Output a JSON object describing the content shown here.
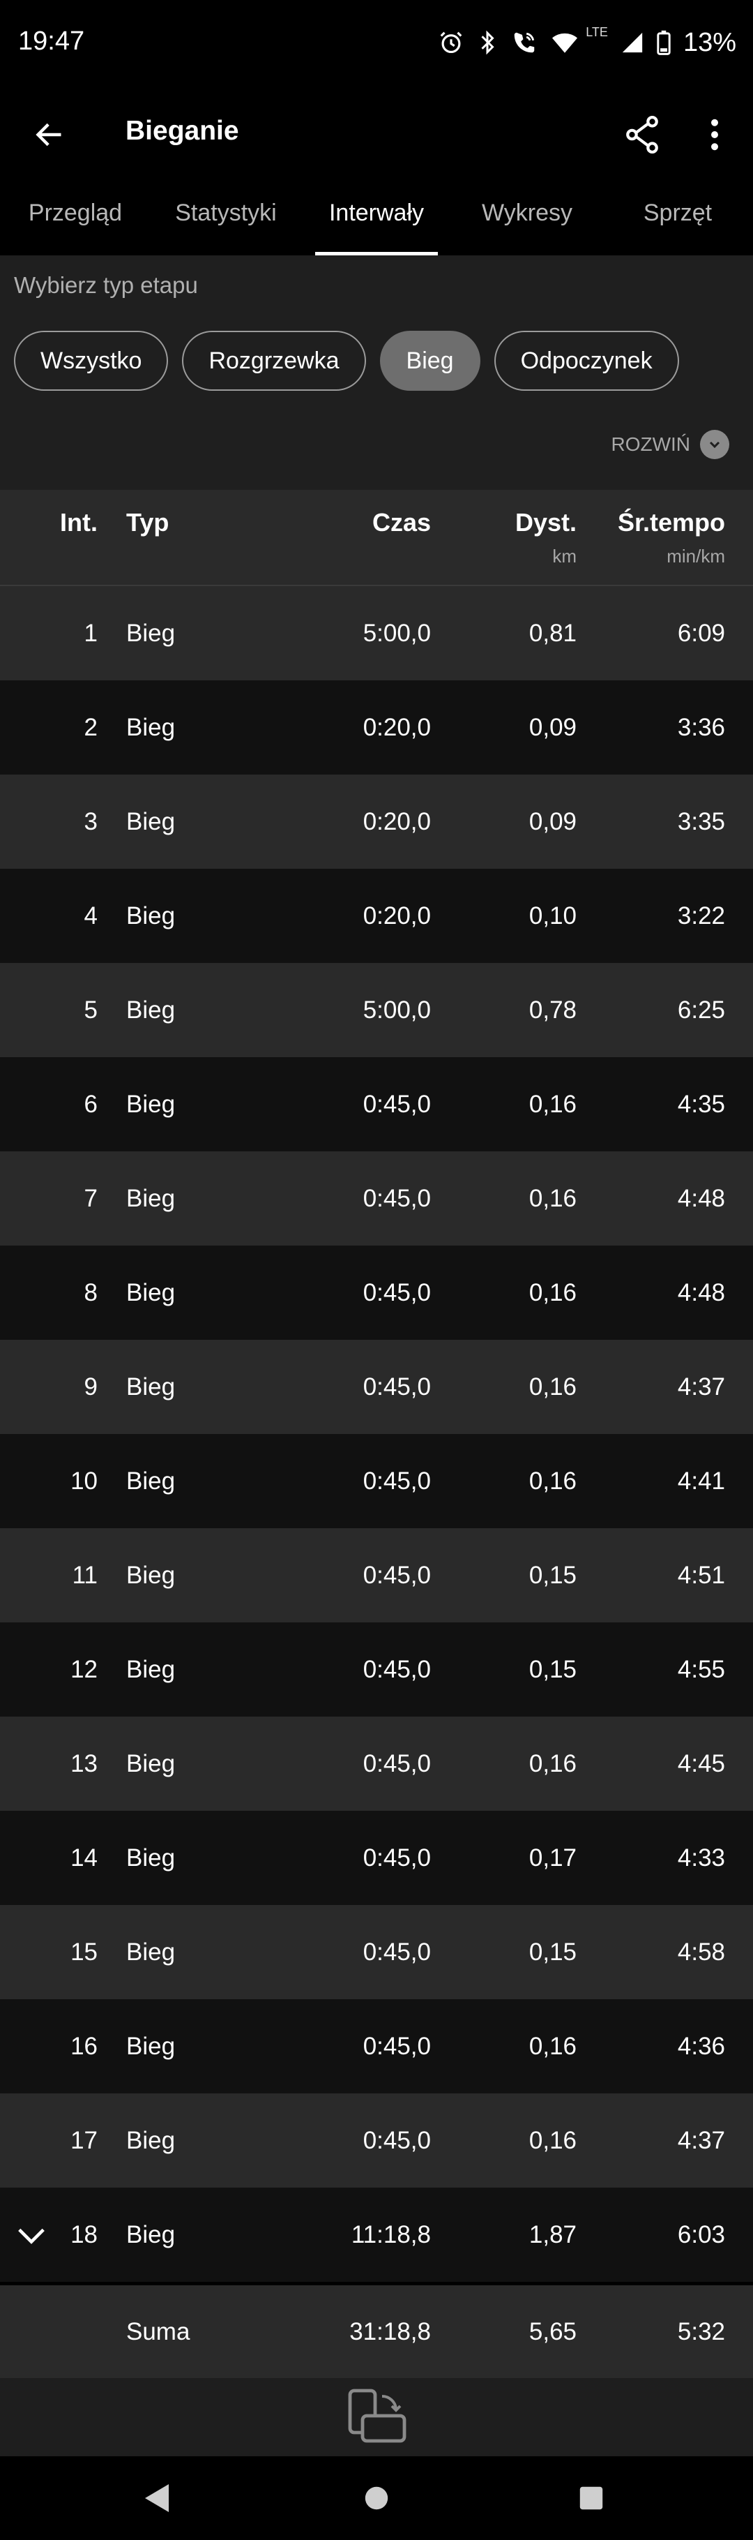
{
  "status_bar": {
    "time": "19:47",
    "battery": "13%",
    "lte": "LTE"
  },
  "app_bar": {
    "title": "Bieganie"
  },
  "tabs": [
    "Przegląd",
    "Statystyki",
    "Interwały",
    "Wykresy",
    "Sprzęt"
  ],
  "active_tab": 2,
  "filter": {
    "label": "Wybierz typ etapu",
    "chips": [
      "Wszystko",
      "Rozgrzewka",
      "Bieg",
      "Odpoczynek"
    ],
    "selected": 2,
    "expand_label": "ROZWIŃ"
  },
  "table": {
    "headers": {
      "int": "Int.",
      "typ": "Typ",
      "czas": "Czas",
      "dyst": "Dyst.",
      "dyst_unit": "km",
      "tempo": "Śr.tempo",
      "tempo_unit": "min/km"
    },
    "rows": [
      {
        "int": "1",
        "typ": "Bieg",
        "czas": "5:00,0",
        "dyst": "0,81",
        "tempo": "6:09"
      },
      {
        "int": "2",
        "typ": "Bieg",
        "czas": "0:20,0",
        "dyst": "0,09",
        "tempo": "3:36"
      },
      {
        "int": "3",
        "typ": "Bieg",
        "czas": "0:20,0",
        "dyst": "0,09",
        "tempo": "3:35"
      },
      {
        "int": "4",
        "typ": "Bieg",
        "czas": "0:20,0",
        "dyst": "0,10",
        "tempo": "3:22"
      },
      {
        "int": "5",
        "typ": "Bieg",
        "czas": "5:00,0",
        "dyst": "0,78",
        "tempo": "6:25"
      },
      {
        "int": "6",
        "typ": "Bieg",
        "czas": "0:45,0",
        "dyst": "0,16",
        "tempo": "4:35"
      },
      {
        "int": "7",
        "typ": "Bieg",
        "czas": "0:45,0",
        "dyst": "0,16",
        "tempo": "4:48"
      },
      {
        "int": "8",
        "typ": "Bieg",
        "czas": "0:45,0",
        "dyst": "0,16",
        "tempo": "4:48"
      },
      {
        "int": "9",
        "typ": "Bieg",
        "czas": "0:45,0",
        "dyst": "0,16",
        "tempo": "4:37"
      },
      {
        "int": "10",
        "typ": "Bieg",
        "czas": "0:45,0",
        "dyst": "0,16",
        "tempo": "4:41"
      },
      {
        "int": "11",
        "typ": "Bieg",
        "czas": "0:45,0",
        "dyst": "0,15",
        "tempo": "4:51"
      },
      {
        "int": "12",
        "typ": "Bieg",
        "czas": "0:45,0",
        "dyst": "0,15",
        "tempo": "4:55"
      },
      {
        "int": "13",
        "typ": "Bieg",
        "czas": "0:45,0",
        "dyst": "0,16",
        "tempo": "4:45"
      },
      {
        "int": "14",
        "typ": "Bieg",
        "czas": "0:45,0",
        "dyst": "0,17",
        "tempo": "4:33"
      },
      {
        "int": "15",
        "typ": "Bieg",
        "czas": "0:45,0",
        "dyst": "0,15",
        "tempo": "4:58"
      },
      {
        "int": "16",
        "typ": "Bieg",
        "czas": "0:45,0",
        "dyst": "0,16",
        "tempo": "4:36"
      },
      {
        "int": "17",
        "typ": "Bieg",
        "czas": "0:45,0",
        "dyst": "0,16",
        "tempo": "4:37"
      },
      {
        "int": "18",
        "typ": "Bieg",
        "czas": "11:18,8",
        "dyst": "1,87",
        "tempo": "6:03",
        "expandable": true
      }
    ],
    "summary": {
      "label": "Suma",
      "czas": "31:18,8",
      "dyst": "5,65",
      "tempo": "5:32"
    }
  },
  "icons": {
    "back": "arrow-back-icon",
    "share": "share-icon",
    "more": "more-vert-icon",
    "expand": "chevron-down-icon",
    "rotate": "screen-rotation-icon"
  }
}
